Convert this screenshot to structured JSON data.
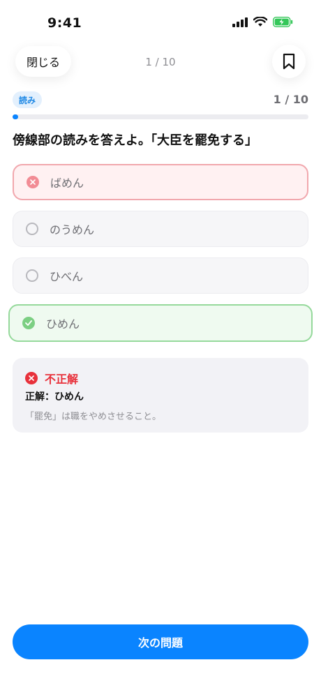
{
  "status_bar": {
    "time": "9:41",
    "icons": [
      "signal-icon",
      "wifi-icon",
      "battery-charging-icon"
    ],
    "battery_color": "#34c759"
  },
  "nav": {
    "close_label": "閉じる",
    "progress": "1 / 10",
    "bookmark_icon": "bookmark-icon"
  },
  "quiz": {
    "category": "読み",
    "progress_count": "1 / 10",
    "progress_fraction": 0.1,
    "question": "傍線部の読みを答えよ。「大臣を罷免する」",
    "choices": [
      {
        "label": "ばめん",
        "state": "selected-wrong"
      },
      {
        "label": "のうめん",
        "state": "unselected"
      },
      {
        "label": "ひべん",
        "state": "unselected"
      },
      {
        "label": "ひめん",
        "state": "correct"
      }
    ]
  },
  "feedback": {
    "status": "不正解",
    "answer": "正解：ひめん",
    "explanation": "「罷免」は職をやめさせること。"
  },
  "footer": {
    "next_label": "次の問題"
  },
  "colors": {
    "accent": "#0a84ff",
    "wrong": "#e8313b",
    "correct": "#7ccf83"
  }
}
